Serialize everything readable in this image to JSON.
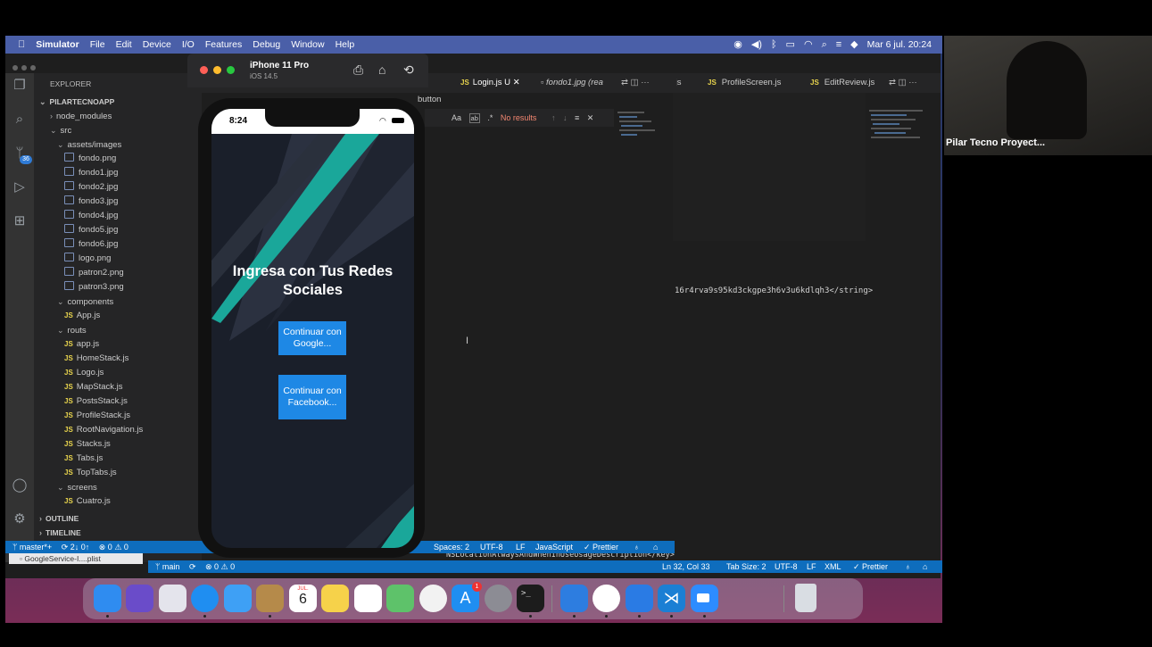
{
  "menubar": {
    "apple_icon": "apple-icon",
    "app_name": "Simulator",
    "items": [
      "File",
      "Edit",
      "Device",
      "I/O",
      "Features",
      "Debug",
      "Window",
      "Help"
    ],
    "clock": "Mar 6 jul.  20:24"
  },
  "simulator": {
    "device_name": "iPhone 11 Pro",
    "os_version": "iOS 14.5",
    "time": "8:24",
    "heading": "Ingresa con Tus Redes Sociales",
    "google_button": "Continuar con Google...",
    "facebook_button": "Continuar con Facebook..."
  },
  "editor_front": {
    "tabs": [
      {
        "label": "Login.js U",
        "icon": "JS"
      },
      {
        "label": "fondo1.jpg (rea",
        "icon": "image"
      }
    ],
    "breadcrumb": "button",
    "find_status": "No results",
    "find_aa": "Aa",
    "find_ab": "ab",
    "status": {
      "spaces": "Spaces: 2",
      "encoding": "UTF-8",
      "eol": "LF",
      "language": "JavaScript",
      "formatter": "✓ Prettier"
    }
  },
  "editor_back": {
    "tabs": [
      {
        "label": ".js",
        "icon": ""
      },
      {
        "label": "ProfileScreen.js",
        "icon": "JS"
      },
      {
        "label": "EditReview.js",
        "icon": "JS"
      }
    ],
    "code_line": "16r4rva9s95kd3ckgpe3h6v3u6kdlqh3</string>",
    "xml_line": "NSLocationAlwaysAndWhenInUseUsageDescription</key>",
    "status": {
      "position": "Ln 32, Col 33",
      "tab_size": "Tab Size: 2",
      "encoding": "UTF-8",
      "eol": "LF",
      "language": "XML",
      "formatter": "✓ Prettier"
    },
    "branch": "main",
    "problems": "⊗ 0 ⚠ 0"
  },
  "explorer": {
    "title": "EXPLORER",
    "project": "PILARTECNOAPP",
    "badge": "36",
    "rows": [
      {
        "label": "node_modules",
        "type": "folder-closed",
        "indent": 1
      },
      {
        "label": "src",
        "type": "folder-open",
        "indent": 1
      },
      {
        "label": "assets/images",
        "type": "folder-open",
        "indent": 2
      },
      {
        "label": "fondo.png",
        "type": "image",
        "indent": 3
      },
      {
        "label": "fondo1.jpg",
        "type": "image",
        "indent": 3
      },
      {
        "label": "fondo2.jpg",
        "type": "image",
        "indent": 3
      },
      {
        "label": "fondo3.jpg",
        "type": "image",
        "indent": 3
      },
      {
        "label": "fondo4.jpg",
        "type": "image",
        "indent": 3
      },
      {
        "label": "fondo5.jpg",
        "type": "image",
        "indent": 3
      },
      {
        "label": "fondo6.jpg",
        "type": "image",
        "indent": 3
      },
      {
        "label": "logo.png",
        "type": "image",
        "indent": 3
      },
      {
        "label": "patron2.png",
        "type": "image",
        "indent": 3
      },
      {
        "label": "patron3.png",
        "type": "image",
        "indent": 3
      },
      {
        "label": "components",
        "type": "folder-open",
        "indent": 2
      },
      {
        "label": "App.js",
        "type": "js",
        "indent": 3
      },
      {
        "label": "routs",
        "type": "folder-open",
        "indent": 2
      },
      {
        "label": "app.js",
        "type": "js",
        "indent": 3
      },
      {
        "label": "HomeStack.js",
        "type": "js",
        "indent": 3
      },
      {
        "label": "Logo.js",
        "type": "js",
        "indent": 3
      },
      {
        "label": "MapStack.js",
        "type": "js",
        "indent": 3
      },
      {
        "label": "PostsStack.js",
        "type": "js",
        "indent": 3
      },
      {
        "label": "ProfileStack.js",
        "type": "js",
        "indent": 3
      },
      {
        "label": "RootNavigation.js",
        "type": "js",
        "indent": 3
      },
      {
        "label": "Stacks.js",
        "type": "js",
        "indent": 3
      },
      {
        "label": "Tabs.js",
        "type": "js",
        "indent": 3
      },
      {
        "label": "TopTabs.js",
        "type": "js",
        "indent": 3
      },
      {
        "label": "screens",
        "type": "folder-open",
        "indent": 2
      },
      {
        "label": "Cuatro.js",
        "type": "js",
        "indent": 3
      }
    ],
    "outline": "OUTLINE",
    "timeline": "TIMELINE",
    "status_branch": "master*+",
    "status_sync": "2↓ 0↑",
    "status_problems": "⊗ 0 ⚠ 0",
    "file_below": "GoogleService-I....plist"
  },
  "webcam": {
    "participant": "Pilar Tecno Proyect..."
  },
  "dock": {
    "apps": [
      {
        "name": "finder-icon",
        "color": "#2f8cf0"
      },
      {
        "name": "siri-icon",
        "color": "#6a4cc9"
      },
      {
        "name": "launchpad-icon",
        "color": "#e4e4ec"
      },
      {
        "name": "safari-icon",
        "color": "#1f8ef1"
      },
      {
        "name": "mail-icon",
        "color": "#3ea0f5"
      },
      {
        "name": "contacts-icon",
        "color": "#b58a4a"
      },
      {
        "name": "calendar-icon",
        "color": "#ffffff"
      },
      {
        "name": "notes-icon",
        "color": "#f6d24a"
      },
      {
        "name": "reminders-icon",
        "color": "#ffffff"
      },
      {
        "name": "maps-icon",
        "color": "#5ec26a"
      },
      {
        "name": "photos-icon",
        "color": "#f2f2f2"
      },
      {
        "name": "app-store-icon",
        "color": "#1f8ef1"
      },
      {
        "name": "system-preferences-icon",
        "color": "#8c8c94"
      },
      {
        "name": "terminal-icon",
        "color": "#1c1c1c"
      },
      {
        "name": "xcode-icon",
        "color": "#2d7de0"
      },
      {
        "name": "chrome-icon",
        "color": "#ffffff"
      },
      {
        "name": "simulator-icon",
        "color": "#2a7be4"
      },
      {
        "name": "vscode-icon",
        "color": "#1b7fd4"
      },
      {
        "name": "zoom-icon",
        "color": "#2d8cff"
      },
      {
        "name": "trash-icon",
        "color": "#d9dde3"
      }
    ],
    "calendar_month": "JUL.",
    "calendar_day": "6",
    "appstore_badge": "1"
  }
}
